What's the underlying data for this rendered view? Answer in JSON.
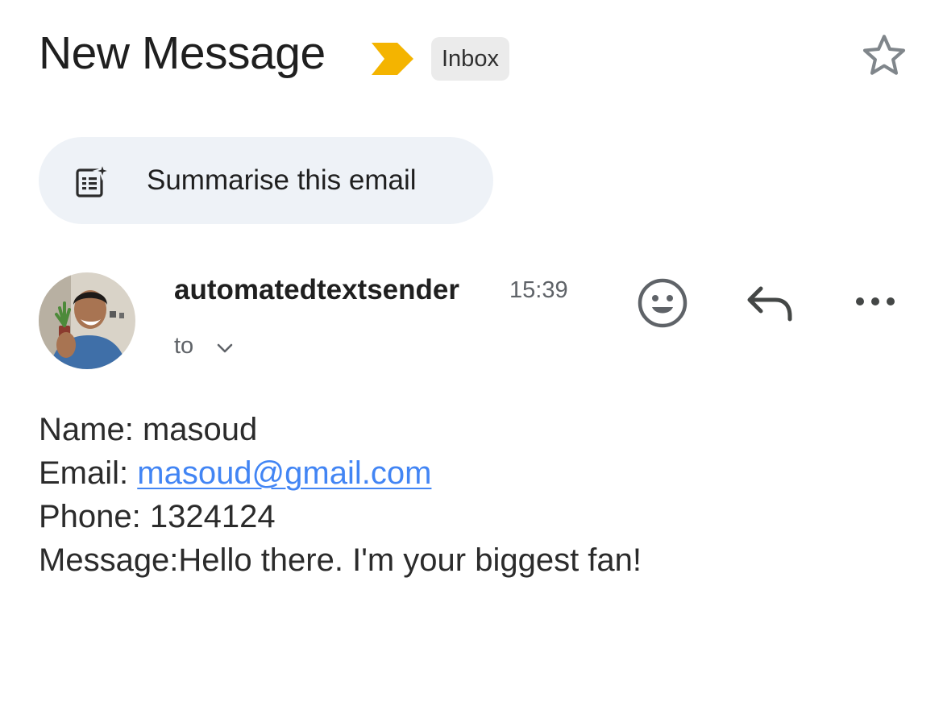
{
  "header": {
    "subject": "New Message",
    "importance_icon": "importance-marker-icon",
    "label": "Inbox",
    "star_icon": "star-outline-icon"
  },
  "summarise": {
    "icon": "summarise-sparkle-icon",
    "label": "Summarise this email"
  },
  "message": {
    "avatar": "sender-avatar-photo",
    "sender": "automatedtextsender",
    "time": "15:39",
    "to_label": "to",
    "to_icon": "chevron-down-icon",
    "actions": {
      "react_icon": "smiley-face-icon",
      "reply_icon": "reply-arrow-icon",
      "more_icon": "more-horizontal-icon"
    },
    "body": {
      "name_label": "Name: ",
      "name_value": "masoud",
      "email_label": "Email: ",
      "email_value": "masoud@gmail.com",
      "phone_label": "Phone: ",
      "phone_value": "1324124",
      "message_label": "Message:",
      "message_value": "Hello there. I'm your biggest fan!"
    }
  },
  "colors": {
    "importance": "#f4b400",
    "link": "#4285f4",
    "chip_bg": "#ebebeb",
    "summarise_bg": "#eef2f7",
    "icon_grey": "#5f6368"
  }
}
